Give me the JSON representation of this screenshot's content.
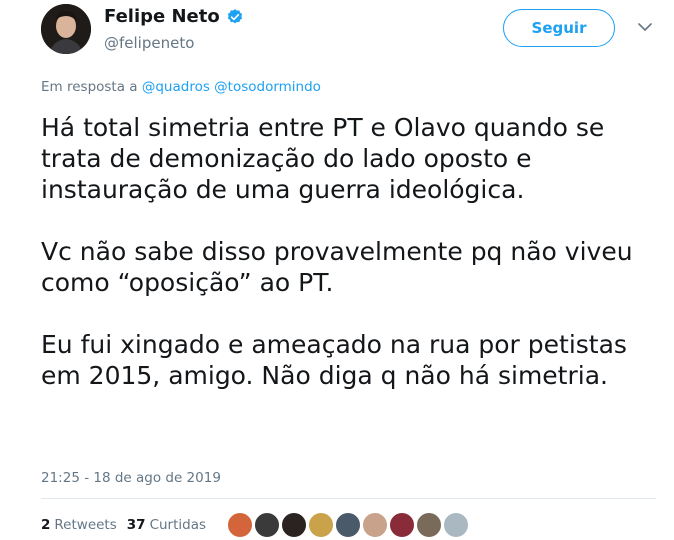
{
  "tweet": {
    "author_name": "Felipe Neto",
    "author_handle": "@felipeneto",
    "follow_label": "Seguir",
    "reply_prefix": "Em resposta a",
    "reply_to": [
      "@quadros",
      "@tosodormindo"
    ],
    "paragraphs": [
      "Há total simetria entre PT e Olavo quando se trata de demonização do lado oposto e instauração de uma guerra ideológica.",
      "Vc não sabe disso provavelmente pq não viveu como “oposição” ao PT.",
      "Eu fui xingado e ameaçado na rua por petistas em 2015, amigo. Não diga q não há simetria."
    ],
    "timestamp": "21:25 - 18 de ago de 2019",
    "retweets_count": "2",
    "retweets_label": "Retweets",
    "likes_count": "37",
    "likes_label": "Curtidas"
  },
  "colors": {
    "accent": "#1da1f2",
    "secondary_text": "#657786",
    "primary_text": "#14171a"
  },
  "icons": {
    "verified": "verified-badge-icon",
    "menu": "chevron-down-icon"
  },
  "liker_avatar_colors": [
    "#d4643a",
    "#3a3a3a",
    "#2a2320",
    "#c9a24a",
    "#4a5a6a",
    "#c8a28a",
    "#8a2b3a",
    "#7a6a5a",
    "#aab8c2"
  ]
}
